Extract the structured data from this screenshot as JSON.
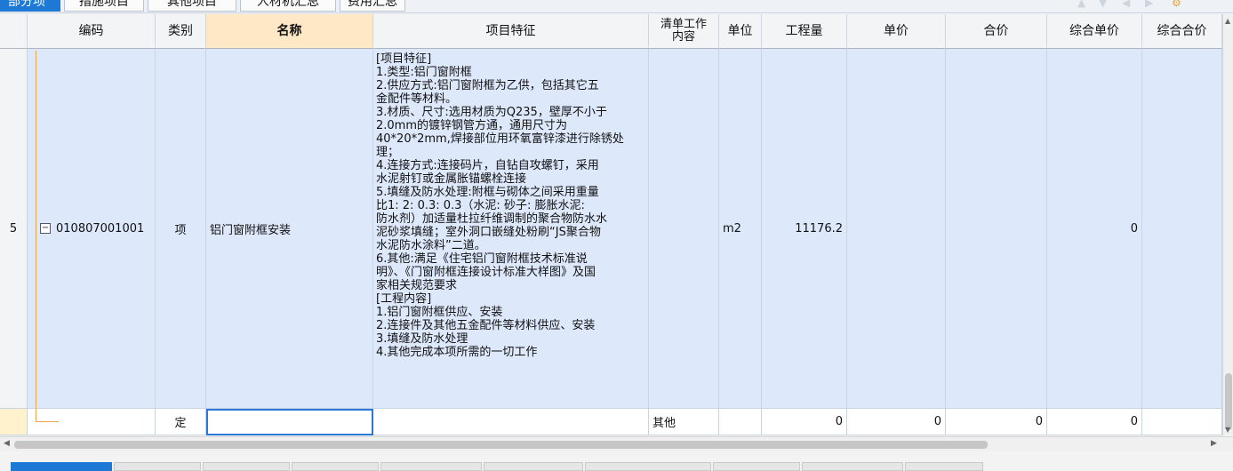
{
  "tabs": [
    {
      "label": "部分项",
      "active": true
    },
    {
      "label": "措施项目",
      "active": false
    },
    {
      "label": "其他项目",
      "active": false
    },
    {
      "label": "人材机汇总",
      "active": false
    },
    {
      "label": "费用汇总",
      "active": false
    }
  ],
  "table": {
    "headers": {
      "code": "编码",
      "category": "类别",
      "name": "名称",
      "feature": "项目特征",
      "work_content": "清单工作内容",
      "unit": "单位",
      "quantity": "工程量",
      "unit_price": "单价",
      "total_price": "合价",
      "composite_unit_price": "综合单价",
      "composite_total": "综合合价"
    },
    "rows": [
      {
        "num": "5",
        "expander": "−",
        "code": "010807001001",
        "category": "项",
        "name": "铝门窗附框安装",
        "feature": "[项目特征]\n1.类型:铝门窗附框\n2.供应方式:铝门窗附框为乙供，包括其它五\n金配件等材料。\n3.材质、尺寸:选用材质为Q235，壁厚不小于\n2.0mm的镀锌钢管方通，通用尺寸为\n40*20*2mm,焊接部位用环氧富锌漆进行除锈处\n理；\n4.连接方式:连接码片，自钻自攻螺钉，采用\n水泥射钉或金属胀锚螺栓连接\n5.填缝及防水处理:附框与砌体之间采用重量\n比1: 2: 0.3: 0.3（水泥: 砂子: 膨胀水泥:\n防水剂）加适量杜拉纤维调制的聚合物防水水\n泥砂浆填缝；室外洞口嵌缝处粉刷“JS聚合物\n水泥防水涂料”二道。\n6.其他:满足《住宅铝门窗附框技术标准说\n明》、《门窗附框连接设计标准大样图》及国\n家相关规范要求\n[工程内容]\n1.铝门窗附框供应、安装\n2.连接件及其他五金配件等材料供应、安装\n3.填缝及防水处理\n4.其他完成本项所需的一切工作",
        "work_content": "",
        "unit": "m2",
        "quantity": "11176.2",
        "unit_price": "",
        "total_price": "",
        "composite_unit_price": "0",
        "composite_total": ""
      },
      {
        "num": "",
        "code": "",
        "category": "定",
        "name": "",
        "feature": "",
        "work_content": "其他",
        "unit": "",
        "quantity": "0",
        "unit_price": "0",
        "total_price": "0",
        "composite_unit_price": "0",
        "composite_total": ""
      }
    ]
  },
  "icons": {
    "toolbar": [
      "arrow-up-icon",
      "arrow-down-icon",
      "arrow-left-icon",
      "arrow-right-icon",
      "gear-icon"
    ],
    "accent_color": "#1e78d6",
    "selected_row_color": "#dde8fb",
    "sorted_header_color": "#ffe8c6"
  }
}
